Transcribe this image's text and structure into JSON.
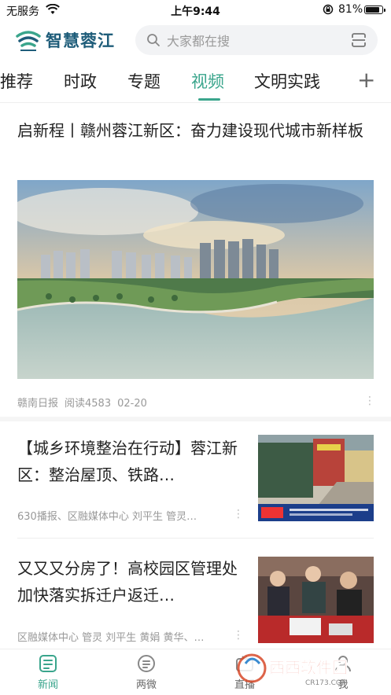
{
  "status_bar": {
    "carrier": "无服务",
    "time": "上午9:44",
    "battery": "81%"
  },
  "header": {
    "brand": "智慧蓉江",
    "search_placeholder": "大家都在搜"
  },
  "tabs": [
    {
      "label": "推荐"
    },
    {
      "label": "时政"
    },
    {
      "label": "专题"
    },
    {
      "label": "视频",
      "active": true
    },
    {
      "label": "文明实践"
    }
  ],
  "tab_add": "+",
  "articles": [
    {
      "title": "启新程丨赣州蓉江新区：奋力建设现代城市新样板",
      "source": "赣南日报",
      "reads": "阅读4583",
      "date": "02-20"
    },
    {
      "title": "【城乡环境整治在行动】蓉江新区：整治屋顶、铁路…",
      "meta": "630播报、区融媒体中心 刘平生 管灵…"
    },
    {
      "title": "又又又分房了！高校园区管理处加快落实拆迁户返迁…",
      "meta": "区融媒体中心 管灵 刘平生 黄娟 黄华、…"
    }
  ],
  "more_glyph": "⋮",
  "bottom_nav": [
    {
      "label": "新闻",
      "active": true,
      "icon": "news-icon"
    },
    {
      "label": "两微",
      "icon": "weibo-icon"
    },
    {
      "label": "直播",
      "icon": "live-icon"
    },
    {
      "label": "我",
      "icon": "profile-icon"
    }
  ],
  "watermark": {
    "text": "西西软件园",
    "sub": "CR173.COM"
  },
  "colors": {
    "accent": "#3aa58c",
    "brand": "#1f5d7a"
  }
}
